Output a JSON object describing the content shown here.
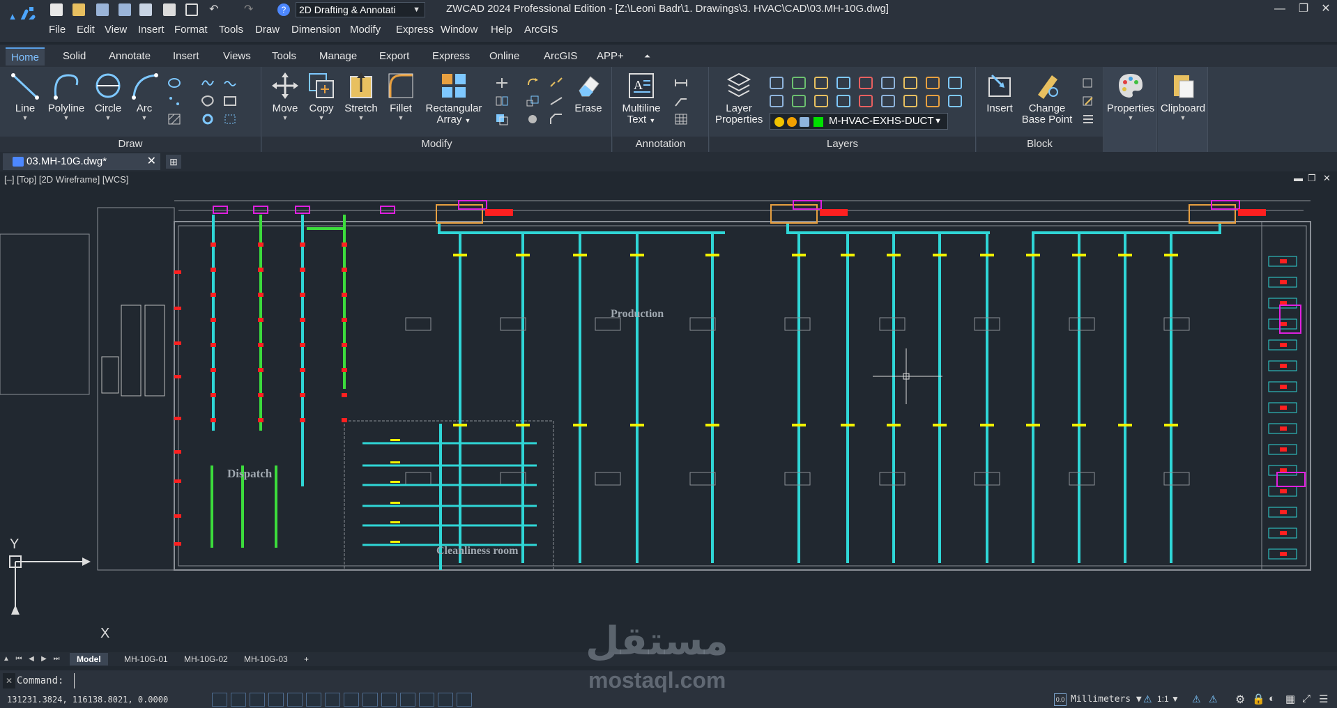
{
  "titlebar": {
    "workspace": "2D Drafting & Annotati",
    "title": "ZWCAD 2024 Professional Edition - [Z:\\Leoni Badr\\1. Drawings\\3. HVAC\\CAD\\03.MH-10G.dwg]"
  },
  "menu": [
    "File",
    "Edit",
    "View",
    "Insert",
    "Format",
    "Tools",
    "Draw",
    "Dimension",
    "Modify",
    "Express",
    "Window",
    "Help",
    "ArcGIS"
  ],
  "ribbon_tabs": [
    "Home",
    "Solid",
    "Annotate",
    "Insert",
    "Views",
    "Tools",
    "Manage",
    "Export",
    "Express",
    "Online",
    "ArcGIS",
    "APP+"
  ],
  "panels": {
    "draw": {
      "title": "Draw",
      "tools": [
        "Line",
        "Polyline",
        "Circle",
        "Arc"
      ]
    },
    "modify": {
      "title": "Modify",
      "tools": [
        "Move",
        "Copy",
        "Stretch",
        "Fillet",
        "Rectangular",
        "Array",
        "Erase"
      ]
    },
    "annotation": {
      "title": "Annotation",
      "tool_line1": "Multiline",
      "tool_line2": "Text"
    },
    "layers": {
      "title": "Layers",
      "tool_line1": "Layer",
      "tool_line2": "Properties",
      "current_layer": "M-HVAC-EXHS-DUCT"
    },
    "block": {
      "title": "Block",
      "insert": "Insert",
      "change_line1": "Change",
      "change_line2": "Base Point"
    },
    "properties": {
      "label": "Properties"
    },
    "clipboard": {
      "label": "Clipboard"
    }
  },
  "document": {
    "tab": "03.MH-10G.dwg*"
  },
  "viewport": {
    "label": "[–] [Top] [2D Wireframe] [WCS]",
    "rooms": {
      "production": "Production",
      "dispatch": "Dispatch",
      "cleanliness": "Cleanliness room"
    },
    "axis": {
      "y": "Y",
      "x": "X"
    }
  },
  "layout_tabs": [
    "Model",
    "MH-10G-01",
    "MH-10G-02",
    "MH-10G-03",
    "+"
  ],
  "command": {
    "prompt": "Command:"
  },
  "status": {
    "coords": "131231.3824, 116138.8021, 0.0000",
    "units_badge": "0.0",
    "units": "Millimeters",
    "scale": "1:1"
  },
  "watermark": {
    "arabic": "مستقل",
    "latin": "mostaql.com"
  },
  "colors": {
    "duct_cyan": "#2fd6d6",
    "duct_green": "#3cdc3c",
    "tag_yellow": "#f2f200",
    "equip_red": "#ff2020",
    "magenta": "#e020e0",
    "wall_gray": "#8a8f96"
  }
}
